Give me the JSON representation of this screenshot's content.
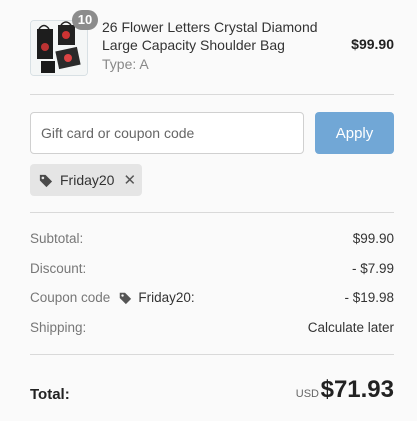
{
  "product": {
    "quantity": "10",
    "name": "26 Flower Letters Crystal Diamond Large Capacity Shoulder Bag",
    "variant": "Type: A",
    "price": "$99.90"
  },
  "coupon": {
    "placeholder": "Gift card or coupon code",
    "apply_label": "Apply",
    "applied_code": "Friday20"
  },
  "summary": {
    "subtotal_label": "Subtotal:",
    "subtotal_value": "$99.90",
    "discount_label": "Discount:",
    "discount_value": "- $7.99",
    "coupon_label": "Coupon code",
    "coupon_code": "Friday20:",
    "coupon_value": "- $19.98",
    "shipping_label": "Shipping:",
    "shipping_value": "Calculate later"
  },
  "total": {
    "label": "Total:",
    "currency": "USD",
    "value": "$71.93"
  },
  "colors": {
    "apply_button": "#71a7d6",
    "badge": "#8c8c8c",
    "chip": "#e5e5e5"
  }
}
